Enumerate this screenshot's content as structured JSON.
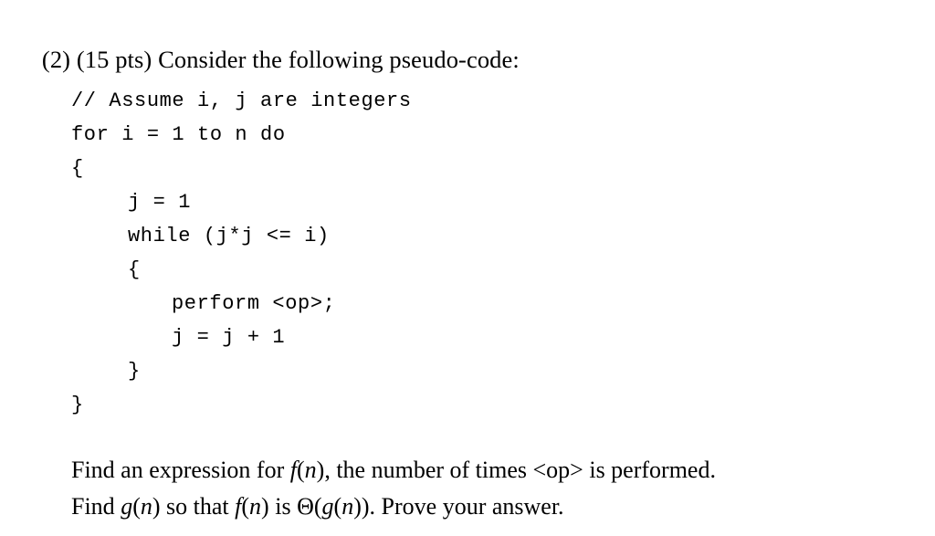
{
  "document": {
    "question": {
      "number_label": "(2)",
      "points_label": "(15 pts)",
      "prompt": "Consider the following pseudo-code:"
    },
    "pseudocode": {
      "lines": [
        {
          "indent": 0,
          "text": "// Assume i, j are integers"
        },
        {
          "indent": 0,
          "text": "for i = 1 to n do"
        },
        {
          "indent": 0,
          "text": "{"
        },
        {
          "indent": 1,
          "text": "j = 1"
        },
        {
          "indent": 1,
          "text": "while (j*j <= i)"
        },
        {
          "indent": 1,
          "text": "{"
        },
        {
          "indent": 2,
          "text": "perform <op>;"
        },
        {
          "indent": 2,
          "text": "j = j + 1"
        },
        {
          "indent": 1,
          "text": "}"
        },
        {
          "indent": 0,
          "text": "}"
        }
      ]
    },
    "closing": {
      "line1": {
        "part1": "Find an expression for ",
        "math_f": "f",
        "paren_open": "(",
        "var_n": "n",
        "paren_close": ")",
        "part2": ", the number of times ",
        "op": "<op>",
        "part3": " is performed."
      },
      "line2": {
        "part1": "Find ",
        "math_g": "g",
        "paren_open": "(",
        "var_n": "n",
        "paren_close": ")",
        "part2": " so that ",
        "math_f": "f",
        "part3": " is ",
        "theta": "Θ",
        "part4": ". Prove your answer."
      }
    }
  },
  "colors": {
    "page_background": "#ffffff",
    "text": "#000000"
  }
}
